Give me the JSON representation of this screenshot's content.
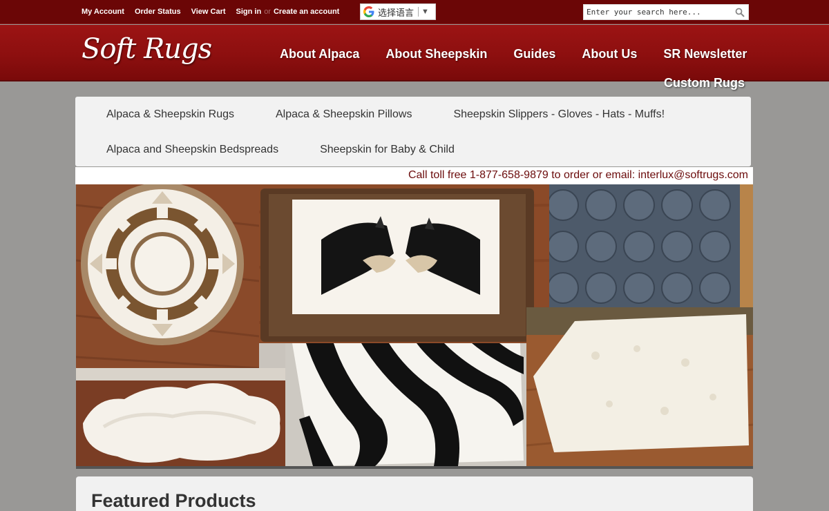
{
  "topbar": {
    "links": [
      "My Account",
      "Order Status",
      "View Cart",
      "Sign in"
    ],
    "or_text": "or",
    "create_account": "Create an account",
    "translate_label": "选择语言",
    "search_placeholder": "Enter your search here..."
  },
  "header": {
    "logo": "Soft Rugs",
    "nav": [
      "About Alpaca",
      "About Sheepskin",
      "Guides",
      "About Us",
      "SR Newsletter"
    ],
    "nav_second_row": "Custom Rugs"
  },
  "submenu": {
    "row1": [
      "Alpaca & Sheepskin Rugs",
      "Alpaca & Sheepskin Pillows",
      "Sheepskin Slippers - Gloves - Hats - Muffs!"
    ],
    "row2": [
      "Alpaca and Sheepskin Bedspreads",
      "Sheepskin for Baby & Child"
    ]
  },
  "contact": "Call toll free 1-877-658-9879 to order or email: interlux@softrugs.com",
  "featured": {
    "title": "Featured Products"
  },
  "colors": {
    "topbar": "#6b0606",
    "header": "#8d0f0f",
    "page_bg": "#999896",
    "accent_text": "#6b0b0b"
  }
}
